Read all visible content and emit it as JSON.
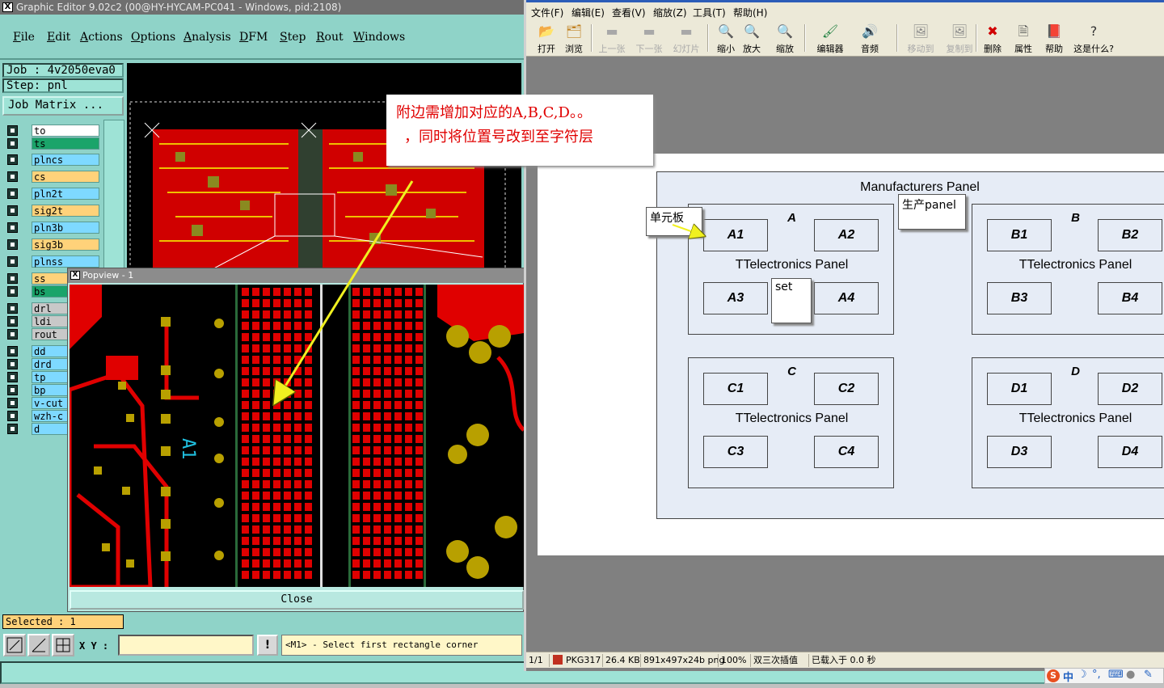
{
  "graphic_editor": {
    "title": "Graphic Editor 9.02c2 (00@HY-HYCAM-PC041 - Windows, pid:2108)",
    "menu": [
      "File",
      "Edit",
      "Actions",
      "Options",
      "Analysis",
      "DFM",
      "Step",
      "Rout",
      "Windows"
    ],
    "job": "Job : 4v2050eva0",
    "step": "Step: pnl",
    "job_matrix": "Job Matrix ...",
    "layers": [
      {
        "name": "to",
        "color": "#ffffff"
      },
      {
        "name": "ts",
        "color": "#1aa46a"
      },
      {
        "name": "plncs",
        "color": "#7ed9ff"
      },
      {
        "name": "cs",
        "color": "#ffd27a"
      },
      {
        "name": "pln2t",
        "color": "#7ed9ff"
      },
      {
        "name": "sig2t",
        "color": "#ffd27a"
      },
      {
        "name": "pln3b",
        "color": "#7ed9ff"
      },
      {
        "name": "sig3b",
        "color": "#ffd27a"
      },
      {
        "name": "plnss",
        "color": "#7ed9ff"
      },
      {
        "name": "ss",
        "color": "#ffd27a"
      },
      {
        "name": "bs",
        "color": "#1aa46a"
      },
      {
        "name": "drl",
        "color": "#c8c8c8"
      },
      {
        "name": "ldi",
        "color": "#c8c8c8"
      },
      {
        "name": "rout",
        "color": "#c8c8c8"
      },
      {
        "name": "dd",
        "color": "#7ed9ff"
      },
      {
        "name": "drd",
        "color": "#7ed9ff"
      },
      {
        "name": "tp",
        "color": "#7ed9ff"
      },
      {
        "name": "bp",
        "color": "#7ed9ff"
      },
      {
        "name": "v-cut",
        "color": "#7ed9ff"
      },
      {
        "name": "wzh-c",
        "color": "#7ed9ff"
      },
      {
        "name": "d",
        "color": "#7ed9ff"
      }
    ],
    "selected": "Selected : 1",
    "xy_label": "X Y :",
    "xy_value": "",
    "prompt": "<M1> - Select first rectangle corner",
    "popview": {
      "title": "Popview - 1",
      "silk_label": "A1",
      "close_label": "Close"
    }
  },
  "annotation": {
    "line1": "附边需增加对应的A,B,C,D。。",
    "line2": "，同时将位置号改到至字符层"
  },
  "image_viewer": {
    "menu": [
      "文件(F)",
      "编辑(E)",
      "查看(V)",
      "缩放(Z)",
      "工具(T)",
      "帮助(H)"
    ],
    "toolbar": [
      {
        "label": "打开",
        "icon": "open-folder-icon",
        "enabled": true
      },
      {
        "label": "浏览",
        "icon": "browse-icon",
        "enabled": true
      },
      {
        "label": "上一张",
        "icon": "prev-icon",
        "enabled": false
      },
      {
        "label": "下一张",
        "icon": "next-icon",
        "enabled": false
      },
      {
        "label": "幻灯片",
        "icon": "slideshow-icon",
        "enabled": false
      },
      {
        "label": "缩小",
        "icon": "zoom-out-icon",
        "enabled": true
      },
      {
        "label": "放大",
        "icon": "zoom-in-icon",
        "enabled": true
      },
      {
        "label": "缩放",
        "icon": "zoom-icon",
        "enabled": true
      },
      {
        "label": "编辑器",
        "icon": "editor-icon",
        "enabled": true
      },
      {
        "label": "音频",
        "icon": "audio-icon",
        "enabled": true
      },
      {
        "label": "移动到",
        "icon": "move-to-icon",
        "enabled": false
      },
      {
        "label": "复制到",
        "icon": "copy-to-icon",
        "enabled": false
      },
      {
        "label": "删除",
        "icon": "delete-icon",
        "enabled": true
      },
      {
        "label": "属性",
        "icon": "properties-icon",
        "enabled": true
      },
      {
        "label": "帮助",
        "icon": "help-book-icon",
        "enabled": true
      },
      {
        "label": "这是什么?",
        "icon": "whats-this-icon",
        "enabled": true
      }
    ],
    "status": {
      "page": "1/1",
      "name": "PKG317",
      "size": "26.4 KB",
      "dims": "891x497x24b png",
      "zoom": "100%",
      "interp": "双三次插值",
      "loaded": "已载入于 0.0 秒"
    },
    "diagram": {
      "title": "Manufacturers Panel",
      "unit_text": "TTelectronics Panel",
      "units": [
        {
          "letter": "A",
          "cells": [
            "A1",
            "A2",
            "A3",
            "A4"
          ]
        },
        {
          "letter": "B",
          "cells": [
            "B1",
            "B2",
            "B3",
            "B4"
          ]
        },
        {
          "letter": "C",
          "cells": [
            "C1",
            "C2",
            "C3",
            "C4"
          ]
        },
        {
          "letter": "D",
          "cells": [
            "D1",
            "D2",
            "D3",
            "D4"
          ]
        }
      ],
      "callouts": {
        "unit_board": "单元板",
        "prod_panel": "生产panel",
        "set": "set"
      }
    }
  },
  "ime": {
    "s": "S",
    "z": "中"
  }
}
